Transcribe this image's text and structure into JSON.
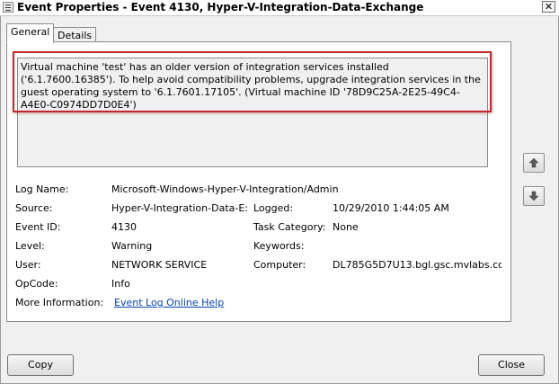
{
  "window": {
    "title": "Event Properties - Event 4130, Hyper-V-Integration-Data-Exchange",
    "close_glyph": "✕"
  },
  "tabs": [
    {
      "label": "General",
      "active": true
    },
    {
      "label": "Details",
      "active": false
    }
  ],
  "message": "Virtual machine 'test' has an older version of integration services installed ('6.1.7600.16385'). To help avoid compatibility problems, upgrade integration services in the guest operating system to '6.1.7601.17105'. (Virtual machine ID '78D9C25A-2E25-49C4-A4E0-C0974DD7D0E4')",
  "fields": {
    "log_name": {
      "label": "Log Name:",
      "value": "Microsoft-Windows-Hyper-V-Integration/Admin"
    },
    "source": {
      "label": "Source:",
      "value": "Hyper-V-Integration-Data-E:"
    },
    "logged": {
      "label": "Logged:",
      "value": "10/29/2010 1:44:05 AM"
    },
    "event_id": {
      "label": "Event ID:",
      "value": "4130"
    },
    "task_category": {
      "label": "Task Category:",
      "value": "None"
    },
    "level": {
      "label": "Level:",
      "value": "Warning"
    },
    "keywords": {
      "label": "Keywords:",
      "value": ""
    },
    "user": {
      "label": "User:",
      "value": "NETWORK SERVICE"
    },
    "computer": {
      "label": "Computer:",
      "value": "DL785G5D7U13.bgl.gsc.mvlabs.co"
    },
    "opcode": {
      "label": "OpCode:",
      "value": "Info"
    },
    "more_info": {
      "label": "More Information:",
      "link": "Event Log Online Help"
    }
  },
  "buttons": {
    "copy": "Copy",
    "close": "Close"
  },
  "icons": {
    "title": "event-viewer-icon",
    "up": "arrow-up-icon",
    "down": "arrow-down-icon"
  },
  "colors": {
    "highlight_frame": "#c0282d",
    "link": "#0645ad"
  }
}
